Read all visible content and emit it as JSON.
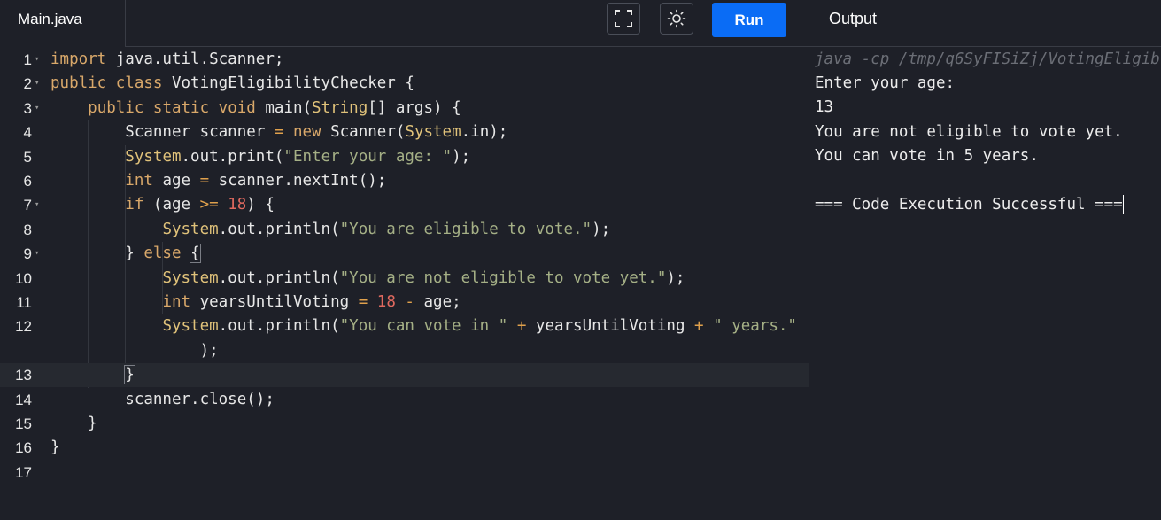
{
  "tab": {
    "file_name": "Main.java"
  },
  "toolbar": {
    "run_label": "Run",
    "fullscreen_icon": "fullscreen-icon",
    "theme_icon": "sun-icon"
  },
  "output": {
    "title": "Output",
    "command": "java -cp /tmp/q6SyFISiZj/VotingEligib",
    "lines": [
      "Enter your age:",
      "13",
      "You are not eligible to vote yet.",
      "You can vote in 5 years.",
      "",
      "=== Code Execution Successful ==="
    ]
  },
  "editor": {
    "lines": [
      {
        "num": "1",
        "fold": true,
        "tokens": [
          [
            "kw",
            "import"
          ],
          [
            "plain",
            " java.util.Scanner;"
          ]
        ]
      },
      {
        "num": "2",
        "fold": true,
        "tokens": [
          [
            "kw",
            "public class"
          ],
          [
            "plain",
            " VotingEligibilityChecker {"
          ]
        ]
      },
      {
        "num": "3",
        "fold": true,
        "tokens": [
          [
            "plain",
            "    "
          ],
          [
            "kw",
            "public static void"
          ],
          [
            "plain",
            " main("
          ],
          [
            "cls",
            "String"
          ],
          [
            "plain",
            "[] args) {"
          ]
        ]
      },
      {
        "num": "4",
        "fold": false,
        "tokens": [
          [
            "plain",
            "        Scanner scanner "
          ],
          [
            "op",
            "="
          ],
          [
            "plain",
            " "
          ],
          [
            "kw",
            "new"
          ],
          [
            "plain",
            " Scanner("
          ],
          [
            "cls",
            "System"
          ],
          [
            "plain",
            ".in);"
          ]
        ]
      },
      {
        "num": "5",
        "fold": false,
        "tokens": [
          [
            "plain",
            "        "
          ],
          [
            "cls",
            "System"
          ],
          [
            "plain",
            ".out.print("
          ],
          [
            "str",
            "\"Enter your age: \""
          ],
          [
            "plain",
            ");"
          ]
        ]
      },
      {
        "num": "6",
        "fold": false,
        "tokens": [
          [
            "plain",
            "        "
          ],
          [
            "kw",
            "int"
          ],
          [
            "plain",
            " age "
          ],
          [
            "op",
            "="
          ],
          [
            "plain",
            " scanner.nextInt();"
          ]
        ]
      },
      {
        "num": "7",
        "fold": true,
        "tokens": [
          [
            "plain",
            "        "
          ],
          [
            "kw",
            "if"
          ],
          [
            "plain",
            " (age "
          ],
          [
            "op",
            ">="
          ],
          [
            "plain",
            " "
          ],
          [
            "num",
            "18"
          ],
          [
            "plain",
            ") {"
          ]
        ]
      },
      {
        "num": "8",
        "fold": false,
        "tokens": [
          [
            "plain",
            "            "
          ],
          [
            "cls",
            "System"
          ],
          [
            "plain",
            ".out.println("
          ],
          [
            "str",
            "\"You are eligible to vote.\""
          ],
          [
            "plain",
            ");"
          ]
        ]
      },
      {
        "num": "9",
        "fold": true,
        "tokens": [
          [
            "plain",
            "        } "
          ],
          [
            "kw",
            "else"
          ],
          [
            "plain",
            " "
          ],
          [
            "brace",
            "{"
          ]
        ]
      },
      {
        "num": "10",
        "fold": false,
        "tokens": [
          [
            "plain",
            "            "
          ],
          [
            "cls",
            "System"
          ],
          [
            "plain",
            ".out.println("
          ],
          [
            "str",
            "\"You are not eligible to vote yet.\""
          ],
          [
            "plain",
            ");"
          ]
        ]
      },
      {
        "num": "11",
        "fold": false,
        "tokens": [
          [
            "plain",
            "            "
          ],
          [
            "kw",
            "int"
          ],
          [
            "plain",
            " yearsUntilVoting "
          ],
          [
            "op",
            "="
          ],
          [
            "plain",
            " "
          ],
          [
            "num",
            "18"
          ],
          [
            "plain",
            " "
          ],
          [
            "op",
            "-"
          ],
          [
            "plain",
            " age;"
          ]
        ]
      },
      {
        "num": "12",
        "fold": false,
        "tokens": [
          [
            "plain",
            "            "
          ],
          [
            "cls",
            "System"
          ],
          [
            "plain",
            ".out.println("
          ],
          [
            "str",
            "\"You can vote in \""
          ],
          [
            "plain",
            " "
          ],
          [
            "op",
            "+"
          ],
          [
            "plain",
            " yearsUntilVoting "
          ],
          [
            "op",
            "+"
          ],
          [
            "plain",
            " "
          ],
          [
            "str",
            "\" years.\""
          ]
        ]
      },
      {
        "num": "",
        "fold": false,
        "tokens": [
          [
            "plain",
            "                "
          ],
          [
            "plain",
            ");"
          ]
        ]
      },
      {
        "num": "13",
        "fold": false,
        "tokens": [
          [
            "plain",
            "        "
          ],
          [
            "brace",
            "}"
          ]
        ]
      },
      {
        "num": "14",
        "fold": false,
        "tokens": [
          [
            "plain",
            "        scanner.close();"
          ]
        ]
      },
      {
        "num": "15",
        "fold": false,
        "tokens": [
          [
            "plain",
            "    }"
          ]
        ]
      },
      {
        "num": "16",
        "fold": false,
        "tokens": [
          [
            "plain",
            "}"
          ]
        ]
      },
      {
        "num": "17",
        "fold": false,
        "tokens": []
      }
    ]
  },
  "colors": {
    "background": "#1e2028",
    "run_button": "#0a6cf5",
    "keyword": "#d9a86a",
    "string": "#a5b086",
    "number": "#e0695f"
  }
}
